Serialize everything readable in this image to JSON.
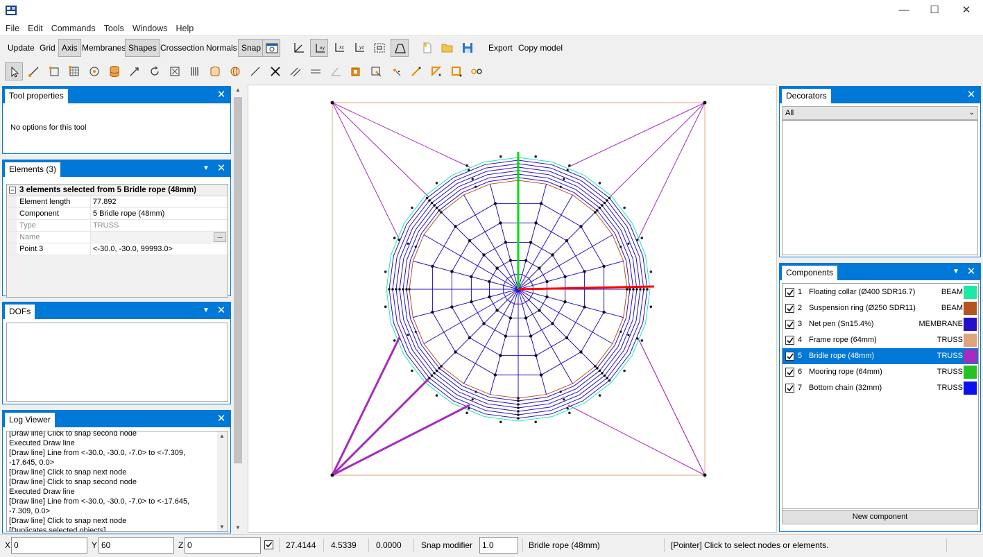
{
  "window": {
    "minimize": "—",
    "maximize": "☐",
    "close": "✕"
  },
  "menu": [
    "File",
    "Edit",
    "Commands",
    "Tools",
    "Windows",
    "Help"
  ],
  "toolbar": {
    "buttons": [
      {
        "label": "Update",
        "on": false
      },
      {
        "label": "Grid",
        "on": false
      },
      {
        "label": "Axis",
        "on": true
      },
      {
        "label": "Membranes",
        "on": false
      },
      {
        "label": "Shapes",
        "on": true
      },
      {
        "label": "Crossection",
        "on": false
      },
      {
        "label": "Normals",
        "on": false
      },
      {
        "label": "Snap",
        "on": true
      }
    ],
    "export_label": "Export",
    "copy_model_label": "Copy model"
  },
  "tool_properties": {
    "title": "Tool properties",
    "message": "No options for this tool"
  },
  "elements": {
    "title": "Elements (3)",
    "group_header": "3 elements selected from 5 Bridle rope (48mm)",
    "rows": [
      {
        "key": "Element length",
        "value": "77.892",
        "muted": false
      },
      {
        "key": "Component",
        "value": "5 Bridle rope (48mm)",
        "muted": false
      },
      {
        "key": "Type",
        "value": "TRUSS",
        "muted": true
      },
      {
        "key": "Name",
        "value": "",
        "muted": true
      },
      {
        "key": "Point 3",
        "value": "<-30.0, -30.0, 99993.0>",
        "muted": false
      }
    ],
    "ellipsis": "..."
  },
  "dofs": {
    "title": "DOFs"
  },
  "log": {
    "title": "Log Viewer",
    "lines": [
      "[Draw line] Click to snap second node",
      "Executed Draw line",
      "[Draw line] Line from <-30.0, -30.0, -7.0> to <-7.309,",
      "-17.645, 0.0>",
      "[Draw line] Click to snap next node",
      "[Draw line] Click to snap second node",
      "Executed Draw line",
      "[Draw line] Line from <-30.0, -30.0, -7.0> to <-17.645,",
      "-7.309, 0.0>",
      "[Draw line] Click to snap next node",
      "[Duplicates selected objects]"
    ]
  },
  "decorators": {
    "title": "Decorators",
    "filter_value": "All"
  },
  "components": {
    "title": "Components",
    "items": [
      {
        "num": "1",
        "name": "Floating collar (Ø400 SDR16.7)",
        "type": "BEAM",
        "color": "#1de9a6",
        "checked": true,
        "selected": false
      },
      {
        "num": "2",
        "name": "Suspension ring (Ø250 SDR11)",
        "type": "BEAM",
        "color": "#b5541f",
        "checked": true,
        "selected": false
      },
      {
        "num": "3",
        "name": "Net pen (Sn15.4%)",
        "type": "MEMBRANE",
        "color": "#2410c8",
        "checked": true,
        "selected": false
      },
      {
        "num": "4",
        "name": "Frame rope (64mm)",
        "type": "TRUSS",
        "color": "#e0a47b",
        "checked": true,
        "selected": false
      },
      {
        "num": "5",
        "name": "Bridle rope (48mm)",
        "type": "TRUSS",
        "color": "#a52cbc",
        "checked": true,
        "selected": true
      },
      {
        "num": "6",
        "name": "Mooring rope (64mm)",
        "type": "TRUSS",
        "color": "#22c322",
        "checked": true,
        "selected": false
      },
      {
        "num": "7",
        "name": "Bottom chain (32mm)",
        "type": "TRUSS",
        "color": "#0a10f0",
        "checked": true,
        "selected": false
      }
    ],
    "new_component_label": "New component"
  },
  "statusbar": {
    "x_label": "X",
    "x_value": "0",
    "y_label": "Y",
    "y_value": "60",
    "z_label": "Z",
    "z_value": "0",
    "coord1": "27.4144",
    "coord2": "4.5339",
    "coord3": "0.0000",
    "snap_modifier_label": "Snap modifier",
    "snap_modifier_value": "1.0",
    "active_component": "Bridle rope (48mm)",
    "hint": "[Pointer] Click to select nodes or elements."
  },
  "colors": {
    "accent": "#0078d7",
    "net": "#2410c8",
    "collar": "#1de9a6",
    "ring": "#b5541f",
    "frame": "#e0a47b",
    "bridle": "#a52cbc",
    "axis_x": "#ff0000",
    "axis_y": "#00e000"
  }
}
